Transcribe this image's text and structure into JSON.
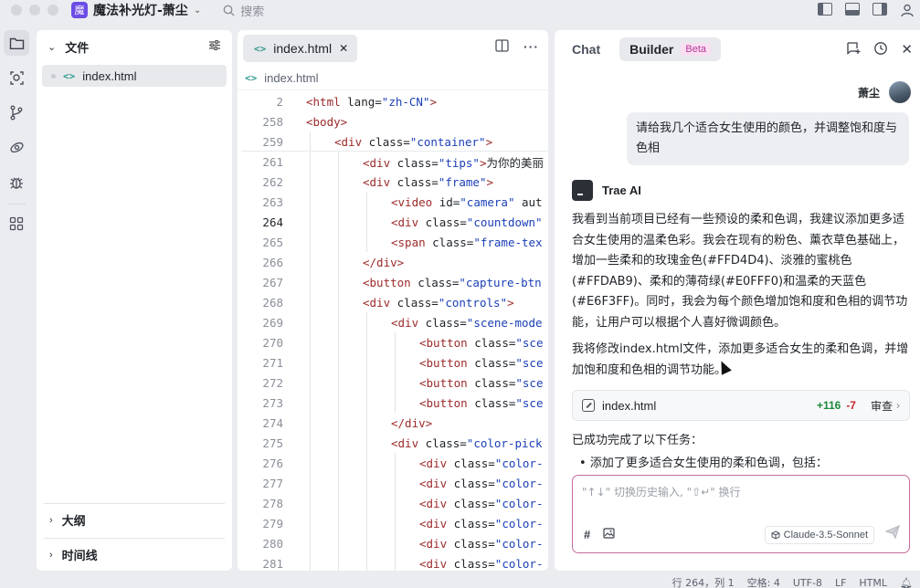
{
  "app": {
    "logo_char": "魔",
    "title": "魔法补光灯-萧尘",
    "search_placeholder": "搜索"
  },
  "explorer": {
    "header": "文件",
    "files": [
      {
        "name": "index.html"
      }
    ],
    "sections": [
      "大纲",
      "时间线"
    ]
  },
  "editor": {
    "tab_name": "index.html",
    "breadcrumb": "index.html",
    "current_line": 264,
    "lines": [
      {
        "n": 2,
        "indent": 0,
        "segs": [
          [
            "tg",
            "<html "
          ],
          [
            "at",
            "lang="
          ],
          [
            "st",
            "\"zh-CN\""
          ],
          [
            "tg",
            ">"
          ]
        ]
      },
      {
        "n": 258,
        "indent": 0,
        "segs": [
          [
            "tg",
            "<body>"
          ]
        ]
      },
      {
        "n": 259,
        "indent": 1,
        "segs": [
          [
            "tg",
            "<div "
          ],
          [
            "at",
            "class="
          ],
          [
            "st",
            "\"container\""
          ],
          [
            "tg",
            ">"
          ]
        ]
      },
      {
        "n": 261,
        "indent": 2,
        "segs": [
          [
            "tg",
            "<div "
          ],
          [
            "at",
            "class="
          ],
          [
            "st",
            "\"tips\""
          ],
          [
            "tg",
            ">"
          ],
          [
            "tx",
            "为你的美丽"
          ]
        ]
      },
      {
        "n": 262,
        "indent": 2,
        "segs": [
          [
            "tg",
            "<div "
          ],
          [
            "at",
            "class="
          ],
          [
            "st",
            "\"frame\""
          ],
          [
            "tg",
            ">"
          ]
        ]
      },
      {
        "n": 263,
        "indent": 3,
        "segs": [
          [
            "tg",
            "<video "
          ],
          [
            "at",
            "id="
          ],
          [
            "st",
            "\"camera\""
          ],
          [
            "at",
            " aut"
          ]
        ]
      },
      {
        "n": 264,
        "indent": 3,
        "segs": [
          [
            "tg",
            "<div "
          ],
          [
            "at",
            "class="
          ],
          [
            "st",
            "\"countdown\""
          ]
        ]
      },
      {
        "n": 265,
        "indent": 3,
        "segs": [
          [
            "tg",
            "<span "
          ],
          [
            "at",
            "class="
          ],
          [
            "st",
            "\"frame-tex"
          ]
        ]
      },
      {
        "n": 266,
        "indent": 2,
        "segs": [
          [
            "tg",
            "</div>"
          ]
        ]
      },
      {
        "n": 267,
        "indent": 2,
        "segs": [
          [
            "tg",
            "<button "
          ],
          [
            "at",
            "class="
          ],
          [
            "st",
            "\"capture-btn"
          ]
        ]
      },
      {
        "n": 268,
        "indent": 2,
        "segs": [
          [
            "tg",
            "<div "
          ],
          [
            "at",
            "class="
          ],
          [
            "st",
            "\"controls\""
          ],
          [
            "tg",
            ">"
          ]
        ]
      },
      {
        "n": 269,
        "indent": 3,
        "segs": [
          [
            "tg",
            "<div "
          ],
          [
            "at",
            "class="
          ],
          [
            "st",
            "\"scene-mode"
          ]
        ]
      },
      {
        "n": 270,
        "indent": 4,
        "segs": [
          [
            "tg",
            "<button "
          ],
          [
            "at",
            "class="
          ],
          [
            "st",
            "\"sce"
          ]
        ]
      },
      {
        "n": 271,
        "indent": 4,
        "segs": [
          [
            "tg",
            "<button "
          ],
          [
            "at",
            "class="
          ],
          [
            "st",
            "\"sce"
          ]
        ]
      },
      {
        "n": 272,
        "indent": 4,
        "segs": [
          [
            "tg",
            "<button "
          ],
          [
            "at",
            "class="
          ],
          [
            "st",
            "\"sce"
          ]
        ]
      },
      {
        "n": 273,
        "indent": 4,
        "segs": [
          [
            "tg",
            "<button "
          ],
          [
            "at",
            "class="
          ],
          [
            "st",
            "\"sce"
          ]
        ]
      },
      {
        "n": 274,
        "indent": 3,
        "segs": [
          [
            "tg",
            "</div>"
          ]
        ]
      },
      {
        "n": 275,
        "indent": 3,
        "segs": [
          [
            "tg",
            "<div "
          ],
          [
            "at",
            "class="
          ],
          [
            "st",
            "\"color-pick"
          ]
        ]
      },
      {
        "n": 276,
        "indent": 4,
        "segs": [
          [
            "tg",
            "<div "
          ],
          [
            "at",
            "class="
          ],
          [
            "st",
            "\"color-"
          ]
        ]
      },
      {
        "n": 277,
        "indent": 4,
        "segs": [
          [
            "tg",
            "<div "
          ],
          [
            "at",
            "class="
          ],
          [
            "st",
            "\"color-"
          ]
        ]
      },
      {
        "n": 278,
        "indent": 4,
        "segs": [
          [
            "tg",
            "<div "
          ],
          [
            "at",
            "class="
          ],
          [
            "st",
            "\"color-"
          ]
        ]
      },
      {
        "n": 279,
        "indent": 4,
        "segs": [
          [
            "tg",
            "<div "
          ],
          [
            "at",
            "class="
          ],
          [
            "st",
            "\"color-"
          ]
        ]
      },
      {
        "n": 280,
        "indent": 4,
        "segs": [
          [
            "tg",
            "<div "
          ],
          [
            "at",
            "class="
          ],
          [
            "st",
            "\"color-"
          ]
        ]
      },
      {
        "n": 281,
        "indent": 4,
        "segs": [
          [
            "tg",
            "<div "
          ],
          [
            "at",
            "class="
          ],
          [
            "st",
            "\"color-"
          ]
        ]
      }
    ]
  },
  "chat": {
    "tabs": {
      "chat": "Chat",
      "builder": "Builder",
      "beta": "Beta"
    },
    "user_name": "萧尘",
    "user_message": "请给我几个适合女生使用的颜色，并调整饱和度与色相",
    "ai_name": "Trae AI",
    "ai_paragraph_1": "我看到当前项目已经有一些预设的柔和色调，我建议添加更多适合女生使用的温柔色彩。我会在现有的粉色、薰衣草色基础上，增加一些柔和的玫瑰金色(#FFD4D4)、淡雅的蜜桃色(#FFDAB9)、柔和的薄荷绿(#E0FFF0)和温柔的天蓝色(#E6F3FF)。同时，我会为每个颜色增加饱和度和色相的调节功能，让用户可以根据个人喜好微调颜色。",
    "ai_paragraph_2": "我将修改index.html文件，添加更多适合女生的柔和色调，并增加饱和度和色相的调节功能。",
    "file_card": {
      "name": "index.html",
      "added": "+116",
      "removed": "-7",
      "review": "审查"
    },
    "done_text": "已成功完成了以下任务：",
    "bullet_text": "添加了更多适合女生使用的柔和色调，包括：",
    "input_placeholder": "\"↑↓\" 切换历史输入, \"⇧↵\" 换行",
    "model": "Claude-3.5-Sonnet"
  },
  "status": {
    "line_col": "行 264，列 1",
    "spaces": "空格: 4",
    "encoding": "UTF-8",
    "eol": "LF",
    "lang": "HTML"
  }
}
